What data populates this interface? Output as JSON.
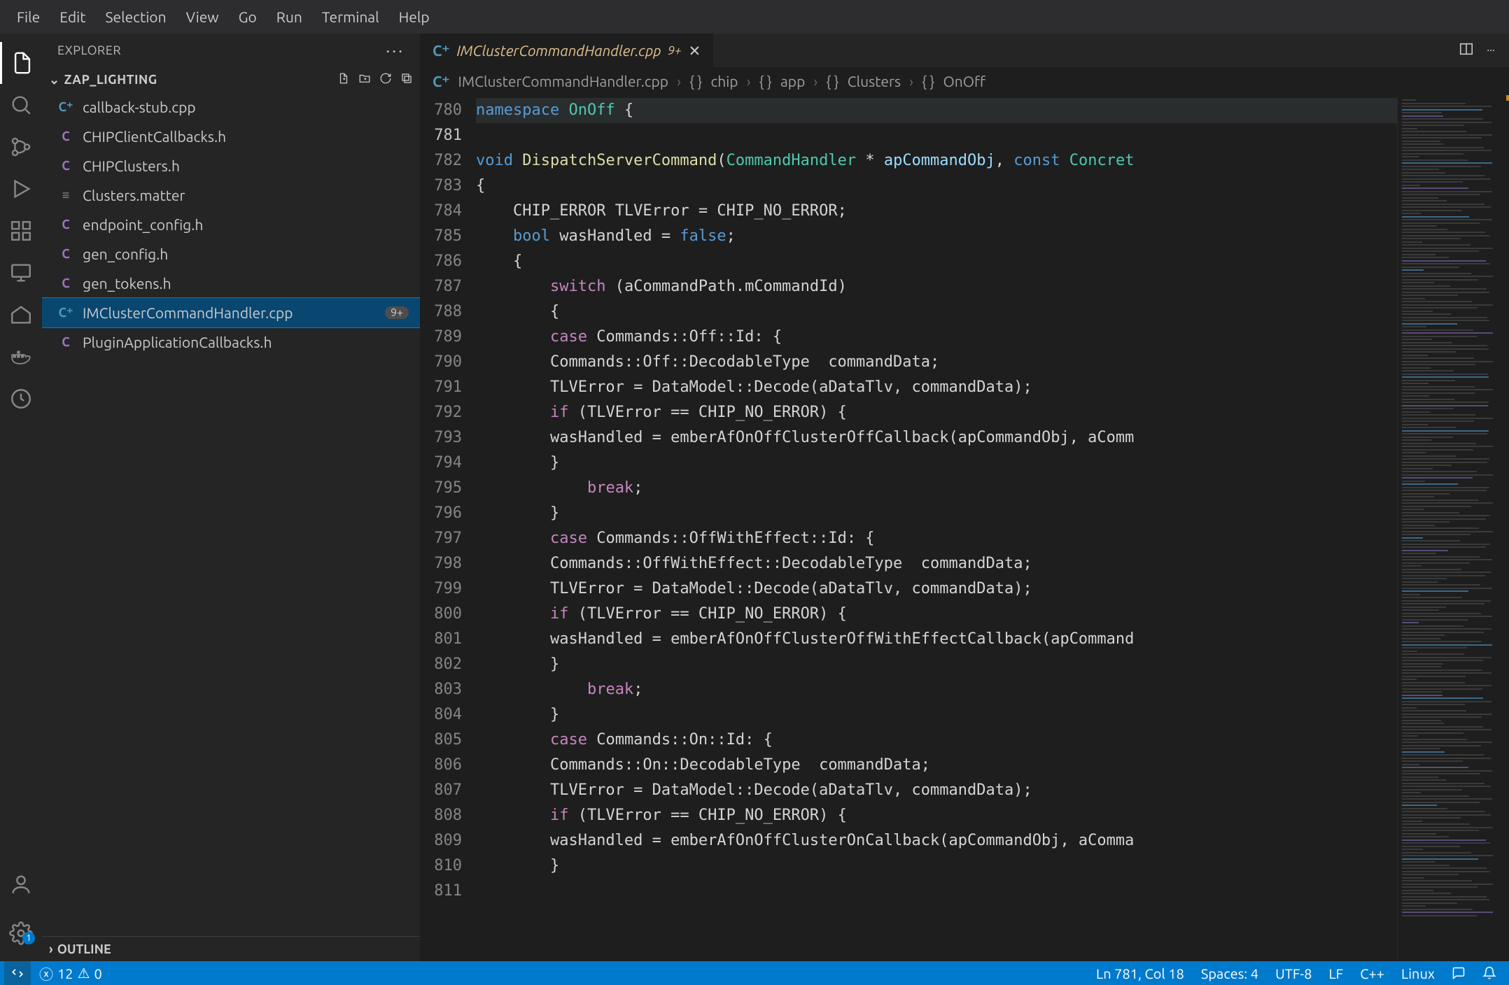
{
  "menubar": [
    "File",
    "Edit",
    "Selection",
    "View",
    "Go",
    "Run",
    "Terminal",
    "Help"
  ],
  "explorer": {
    "title": "EXPLORER",
    "folder": "ZAP_LIGHTING",
    "outline": "OUTLINE",
    "files": [
      {
        "name": "callback-stub.cpp",
        "icon": "cpp"
      },
      {
        "name": "CHIPClientCallbacks.h",
        "icon": "h"
      },
      {
        "name": "CHIPClusters.h",
        "icon": "h"
      },
      {
        "name": "Clusters.matter",
        "icon": "m"
      },
      {
        "name": "endpoint_config.h",
        "icon": "h"
      },
      {
        "name": "gen_config.h",
        "icon": "h"
      },
      {
        "name": "gen_tokens.h",
        "icon": "h"
      },
      {
        "name": "IMClusterCommandHandler.cpp",
        "icon": "cpp",
        "selected": true,
        "badge": "9+"
      },
      {
        "name": "PluginApplicationCallbacks.h",
        "icon": "h"
      }
    ]
  },
  "tabs": [
    {
      "name": "IMClusterCommandHandler.cpp",
      "modified": "9+",
      "active": true
    }
  ],
  "breadcrumbs": [
    "IMClusterCommandHandler.cpp",
    "chip",
    "app",
    "Clusters",
    "OnOff"
  ],
  "editor": {
    "startLine": 780,
    "currentLine": 781,
    "lines": [
      {
        "n": 780,
        "tokens": [
          {
            "t": "",
            "c": ""
          }
        ]
      },
      {
        "n": 781,
        "hl": true,
        "tokens": [
          {
            "t": "namespace ",
            "c": "tk-kw"
          },
          {
            "t": "OnOff",
            "c": "tk-type"
          },
          {
            "t": " {",
            "c": ""
          }
        ]
      },
      {
        "n": 782,
        "tokens": []
      },
      {
        "n": 783,
        "tokens": [
          {
            "t": "void ",
            "c": "tk-kw"
          },
          {
            "t": "DispatchServerCommand",
            "c": "tk-func"
          },
          {
            "t": "(",
            "c": ""
          },
          {
            "t": "CommandHandler",
            "c": "tk-type"
          },
          {
            "t": " * ",
            "c": ""
          },
          {
            "t": "apCommandObj",
            "c": "tk-var"
          },
          {
            "t": ", ",
            "c": ""
          },
          {
            "t": "const ",
            "c": "tk-kw"
          },
          {
            "t": "Concret",
            "c": "tk-type"
          }
        ]
      },
      {
        "n": 784,
        "tokens": [
          {
            "t": "{",
            "c": ""
          }
        ]
      },
      {
        "n": 785,
        "tokens": [
          {
            "t": "    ",
            "c": ""
          },
          {
            "t": "CHIP_ERROR",
            "c": ""
          },
          {
            "t": " ",
            "c": ""
          },
          {
            "t": "TLVError",
            "c": ""
          },
          {
            "t": " = ",
            "c": ""
          },
          {
            "t": "CHIP_NO_ERROR",
            "c": ""
          },
          {
            "t": ";",
            "c": ""
          }
        ]
      },
      {
        "n": 786,
        "tokens": [
          {
            "t": "    ",
            "c": ""
          },
          {
            "t": "bool ",
            "c": "tk-kw"
          },
          {
            "t": "wasHandled",
            "c": ""
          },
          {
            "t": " = ",
            "c": ""
          },
          {
            "t": "false",
            "c": "tk-lit"
          },
          {
            "t": ";",
            "c": ""
          }
        ]
      },
      {
        "n": 787,
        "tokens": [
          {
            "t": "    {",
            "c": ""
          }
        ]
      },
      {
        "n": 788,
        "tokens": [
          {
            "t": "        ",
            "c": ""
          },
          {
            "t": "switch",
            "c": "tk-ctl"
          },
          {
            "t": " (",
            "c": ""
          },
          {
            "t": "aCommandPath",
            "c": ""
          },
          {
            "t": ".",
            "c": ""
          },
          {
            "t": "mCommandId",
            "c": ""
          },
          {
            "t": ")",
            "c": ""
          }
        ]
      },
      {
        "n": 789,
        "tokens": [
          {
            "t": "        {",
            "c": ""
          }
        ]
      },
      {
        "n": 790,
        "tokens": [
          {
            "t": "        ",
            "c": ""
          },
          {
            "t": "case ",
            "c": "tk-ctl"
          },
          {
            "t": "Commands::Off::Id: {",
            "c": ""
          }
        ]
      },
      {
        "n": 791,
        "tokens": [
          {
            "t": "        Commands::Off::DecodableType  commandData;",
            "c": ""
          }
        ]
      },
      {
        "n": 792,
        "tokens": [
          {
            "t": "        TLVError = DataModel::Decode(aDataTlv, commandData);",
            "c": ""
          }
        ]
      },
      {
        "n": 793,
        "tokens": [
          {
            "t": "        ",
            "c": ""
          },
          {
            "t": "if",
            "c": "tk-ctl"
          },
          {
            "t": " (TLVError == CHIP_NO_ERROR) {",
            "c": ""
          }
        ]
      },
      {
        "n": 794,
        "tokens": [
          {
            "t": "        wasHandled = emberAfOnOffClusterOffCallback(apCommandObj, aComm",
            "c": ""
          }
        ]
      },
      {
        "n": 795,
        "tokens": [
          {
            "t": "        }",
            "c": ""
          }
        ]
      },
      {
        "n": 796,
        "tokens": [
          {
            "t": "            ",
            "c": ""
          },
          {
            "t": "break",
            "c": "tk-ctl"
          },
          {
            "t": ";",
            "c": ""
          }
        ]
      },
      {
        "n": 797,
        "tokens": [
          {
            "t": "        }",
            "c": ""
          }
        ]
      },
      {
        "n": 798,
        "tokens": [
          {
            "t": "        ",
            "c": ""
          },
          {
            "t": "case ",
            "c": "tk-ctl"
          },
          {
            "t": "Commands::OffWithEffect::Id: {",
            "c": ""
          }
        ]
      },
      {
        "n": 799,
        "tokens": [
          {
            "t": "        Commands::OffWithEffect::DecodableType  commandData;",
            "c": ""
          }
        ]
      },
      {
        "n": 800,
        "tokens": [
          {
            "t": "        TLVError = DataModel::Decode(aDataTlv, commandData);",
            "c": ""
          }
        ]
      },
      {
        "n": 801,
        "tokens": [
          {
            "t": "        ",
            "c": ""
          },
          {
            "t": "if",
            "c": "tk-ctl"
          },
          {
            "t": " (TLVError == CHIP_NO_ERROR) {",
            "c": ""
          }
        ]
      },
      {
        "n": 802,
        "tokens": [
          {
            "t": "        wasHandled = emberAfOnOffClusterOffWithEffectCallback(apCommand",
            "c": ""
          }
        ]
      },
      {
        "n": 803,
        "tokens": [
          {
            "t": "        }",
            "c": ""
          }
        ]
      },
      {
        "n": 804,
        "tokens": [
          {
            "t": "            ",
            "c": ""
          },
          {
            "t": "break",
            "c": "tk-ctl"
          },
          {
            "t": ";",
            "c": ""
          }
        ]
      },
      {
        "n": 805,
        "tokens": [
          {
            "t": "        }",
            "c": ""
          }
        ]
      },
      {
        "n": 806,
        "tokens": [
          {
            "t": "        ",
            "c": ""
          },
          {
            "t": "case ",
            "c": "tk-ctl"
          },
          {
            "t": "Commands::On::Id: {",
            "c": ""
          }
        ]
      },
      {
        "n": 807,
        "tokens": [
          {
            "t": "        Commands::On::DecodableType  commandData;",
            "c": ""
          }
        ]
      },
      {
        "n": 808,
        "tokens": [
          {
            "t": "        TLVError = DataModel::Decode(aDataTlv, commandData);",
            "c": ""
          }
        ]
      },
      {
        "n": 809,
        "tokens": [
          {
            "t": "        ",
            "c": ""
          },
          {
            "t": "if",
            "c": "tk-ctl"
          },
          {
            "t": " (TLVError == CHIP_NO_ERROR) {",
            "c": ""
          }
        ]
      },
      {
        "n": 810,
        "tokens": [
          {
            "t": "        wasHandled = emberAfOnOffClusterOnCallback(apCommandObj, aComma",
            "c": ""
          }
        ]
      },
      {
        "n": 811,
        "tokens": [
          {
            "t": "        }",
            "c": ""
          }
        ]
      }
    ]
  },
  "status": {
    "errors": "12",
    "warnings": "0",
    "cursor": "Ln 781, Col 18",
    "spaces": "Spaces: 4",
    "encoding": "UTF-8",
    "eol": "LF",
    "lang": "C++",
    "os": "Linux",
    "settingsBadge": "1"
  }
}
